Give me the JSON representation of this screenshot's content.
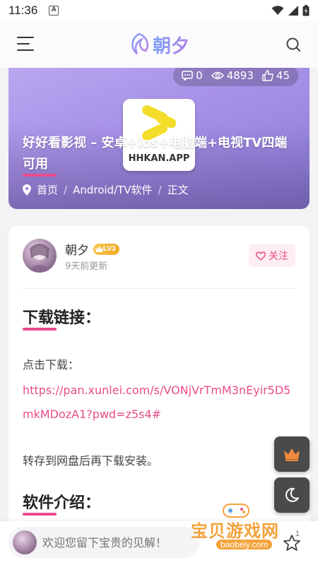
{
  "status_bar": {
    "time": "11:36",
    "notification_icon_letter": "A"
  },
  "header": {
    "brand": "朝夕"
  },
  "hero": {
    "comments": "0",
    "views": "4893",
    "likes": "45",
    "app_label": "HHKAN.APP",
    "title": "好好看影视 – 安卓+ios+电脑端+电视TV四端可用",
    "breadcrumb": {
      "home": "首页",
      "category": "Android/TV软件",
      "current": "正文"
    }
  },
  "author": {
    "name": "朝夕",
    "level": "LV3",
    "updated": "9天前更新",
    "follow_label": "关注"
  },
  "content": {
    "download_heading": "下载链接：",
    "click_download": "点击下载：",
    "link_url": "https://pan.xunlei.com/s/VONjVrTmM3nEyir5D5mkMDozA1?pwd=z5s4#",
    "save_note": "转存到网盘后再下载安装。",
    "intro_heading": "软件介绍："
  },
  "comment_bar": {
    "placeholder": "欢迎您留下宝贵的见解！",
    "like_count": "1"
  },
  "watermark": {
    "text": "宝贝游戏网",
    "url": "baobeiy.com"
  },
  "colors": {
    "accent": "#e94b8a",
    "hero": "#a792e8",
    "fab": "#4a4a4a",
    "crown": "#f08a3c"
  }
}
